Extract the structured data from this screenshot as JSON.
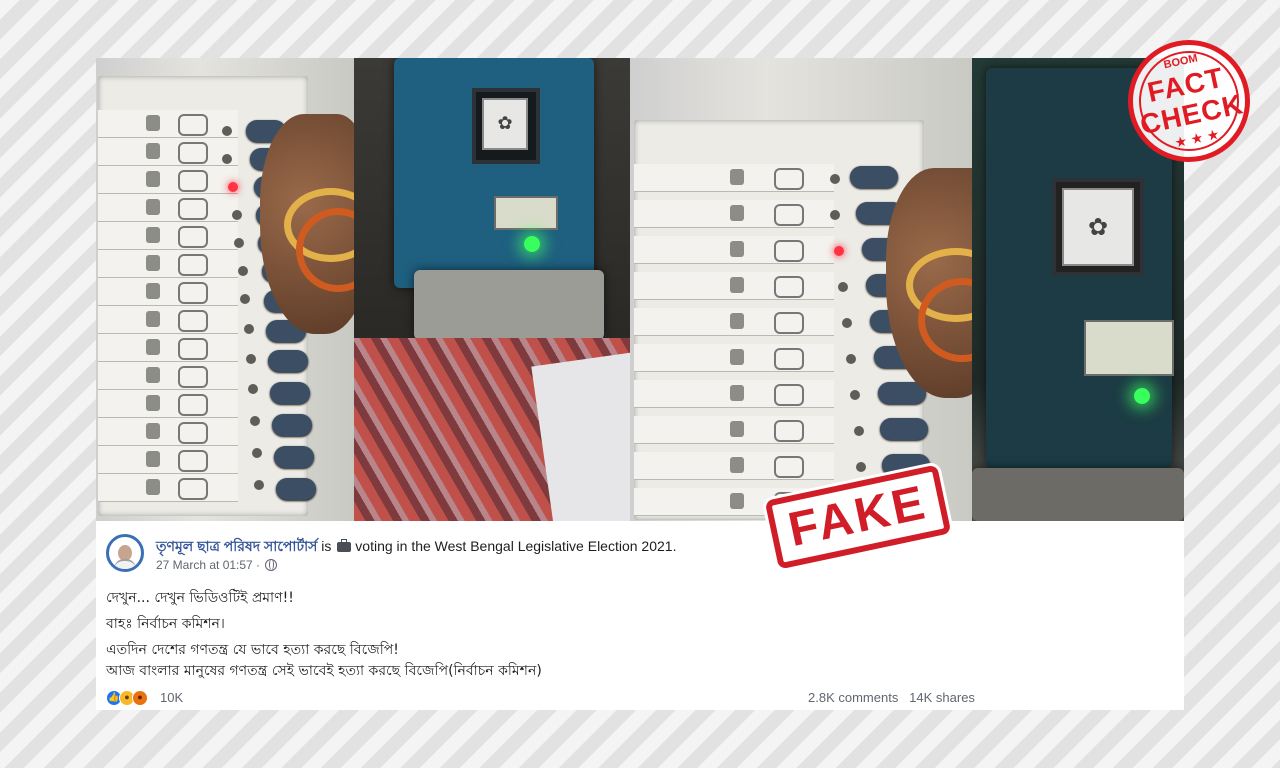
{
  "post": {
    "page_name": "তৃণমূল ছাত্র পরিষদ সাপোর্টার্স",
    "verb": "is",
    "activity": "voting in the West Bengal Legislative Election 2021.",
    "date": "27 March at 01:57 ·",
    "lines": [
      "দেখুন... দেখুন ভিডিওটিই প্রমাণ!!",
      "বাহঃ নির্বাচন কমিশন।",
      "এতদিন দেশের গণতন্ত্র যে ভাবে হত্যা করছে বিজেপি!",
      "আজ বাংলার মানুষের গণতন্ত্র সেই ভাবেই হত্যা করছে বিজেপি(নির্বাচন কমিশন)"
    ],
    "reaction_count": "10K",
    "comments": "2.8K comments",
    "shares": "14K shares"
  },
  "stamps": {
    "boom": "BOOM",
    "fact": "FACT",
    "check": "CHECK",
    "stars": "★ ★ ★",
    "fake": "FAKE"
  },
  "icons": [
    "suitcase-icon",
    "globe-icon",
    "like-reaction-icon",
    "haha-reaction-icon",
    "angry-reaction-icon",
    "lotus-symbol-icon"
  ],
  "colors": {
    "link": "#385898",
    "stamp_red": "#e01b24",
    "meta": "#606770"
  }
}
